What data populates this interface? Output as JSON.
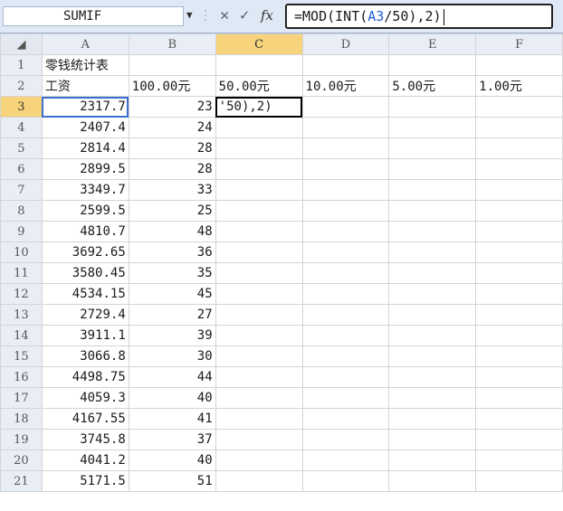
{
  "formula_bar": {
    "name_box": "SUMIF",
    "formula_prefix": "=MOD(INT(",
    "formula_ref": "A3",
    "formula_suffix": "/50),2)"
  },
  "columns": [
    "A",
    "B",
    "C",
    "D",
    "E",
    "F"
  ],
  "rows": [
    {
      "n": "1",
      "a": "零钱统计表",
      "b": "",
      "c": "",
      "d": "",
      "e": "",
      "f": ""
    },
    {
      "n": "2",
      "a": "工资",
      "b": "100.00元",
      "c": "50.00元",
      "d": "10.00元",
      "e": "5.00元",
      "f": "1.00元"
    },
    {
      "n": "3",
      "a": "2317.7",
      "b": "23",
      "c": "'50),2)",
      "d": "",
      "e": "",
      "f": ""
    },
    {
      "n": "4",
      "a": "2407.4",
      "b": "24"
    },
    {
      "n": "5",
      "a": "2814.4",
      "b": "28"
    },
    {
      "n": "6",
      "a": "2899.5",
      "b": "28"
    },
    {
      "n": "7",
      "a": "3349.7",
      "b": "33"
    },
    {
      "n": "8",
      "a": "2599.5",
      "b": "25"
    },
    {
      "n": "9",
      "a": "4810.7",
      "b": "48"
    },
    {
      "n": "10",
      "a": "3692.65",
      "b": "36"
    },
    {
      "n": "11",
      "a": "3580.45",
      "b": "35"
    },
    {
      "n": "12",
      "a": "4534.15",
      "b": "45"
    },
    {
      "n": "13",
      "a": "2729.4",
      "b": "27"
    },
    {
      "n": "14",
      "a": "3911.1",
      "b": "39"
    },
    {
      "n": "15",
      "a": "3066.8",
      "b": "30"
    },
    {
      "n": "16",
      "a": "4498.75",
      "b": "44"
    },
    {
      "n": "17",
      "a": "4059.3",
      "b": "40"
    },
    {
      "n": "18",
      "a": "4167.55",
      "b": "41"
    },
    {
      "n": "19",
      "a": "3745.8",
      "b": "37"
    },
    {
      "n": "20",
      "a": "4041.2",
      "b": "40"
    },
    {
      "n": "21",
      "a": "5171.5",
      "b": "51"
    }
  ]
}
